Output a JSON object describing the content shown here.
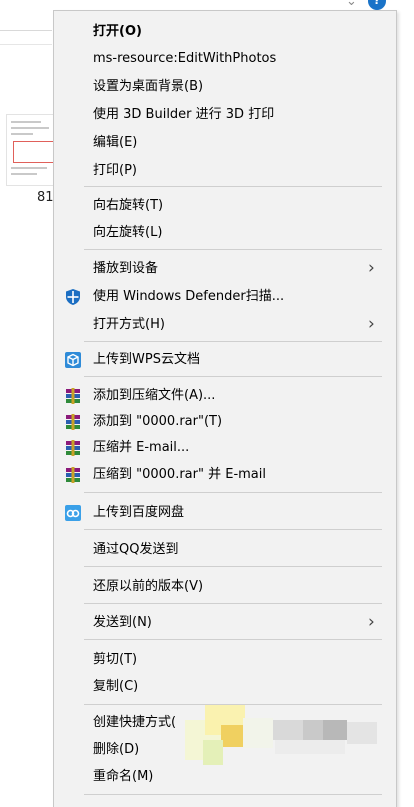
{
  "background": {
    "file_name": "81",
    "chevron": "⌄",
    "help_label": "?"
  },
  "menu": {
    "items": [
      {
        "label": "打开(O)",
        "bold": true
      },
      {
        "label": "ms-resource:EditWithPhotos"
      },
      {
        "label": "设置为桌面背景(B)"
      },
      {
        "label": "使用 3D Builder 进行 3D 打印"
      },
      {
        "label": "编辑(E)"
      },
      {
        "label": "打印(P)"
      },
      {
        "label": "向右旋转(T)"
      },
      {
        "label": "向左旋转(L)"
      },
      {
        "label": "播放到设备",
        "submenu": true
      },
      {
        "label": "使用 Windows Defender扫描...",
        "icon": "windows-defender-shield-icon"
      },
      {
        "label": "打开方式(H)",
        "submenu": true
      },
      {
        "label": "上传到WPS云文档",
        "icon": "wps-cloud-icon"
      },
      {
        "label": "添加到压缩文件(A)...",
        "icon": "winrar-archive-icon"
      },
      {
        "label": "添加到 \"0000.rar\"(T)",
        "icon": "winrar-archive-icon"
      },
      {
        "label": "压缩并 E-mail...",
        "icon": "winrar-archive-icon"
      },
      {
        "label": "压缩到 \"0000.rar\" 并 E-mail",
        "icon": "winrar-archive-icon"
      },
      {
        "label": "上传到百度网盘",
        "icon": "baidu-netdisk-icon"
      },
      {
        "label": "通过QQ发送到"
      },
      {
        "label": "还原以前的版本(V)"
      },
      {
        "label": "发送到(N)",
        "submenu": true
      },
      {
        "label": "剪切(T)"
      },
      {
        "label": "复制(C)"
      },
      {
        "label": "创建快捷方式("
      },
      {
        "label": "删除(D)"
      },
      {
        "label": "重命名(M)"
      }
    ],
    "submenu_arrow": "›"
  },
  "colors": {
    "menu_bg": "#f2f2f2",
    "separator": "#cfcfcf",
    "defender_blue": "#1b6ec2",
    "wps_blue": "#2f8bd8",
    "baidu_blue": "#3aa0e8"
  }
}
